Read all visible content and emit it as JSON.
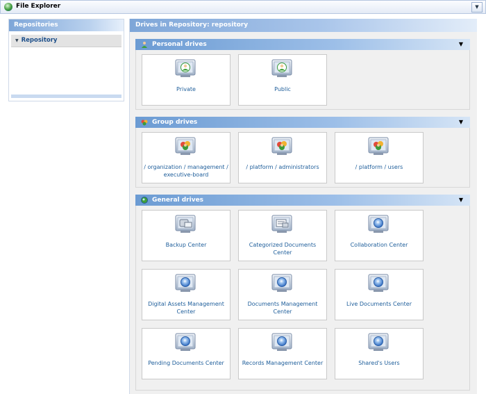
{
  "window": {
    "title": "File Explorer",
    "menu_glyph": "▼"
  },
  "left": {
    "header": "Repositories",
    "items": [
      {
        "label": "Repository",
        "arrow": "▼"
      }
    ]
  },
  "right": {
    "header": "Drives in Repository: repository",
    "collapse_glyph": "▼",
    "sections": [
      {
        "title": "Personal drives",
        "icon": "user-icon",
        "drives": [
          {
            "label": "Private",
            "icon": "user-drive-icon"
          },
          {
            "label": "Public",
            "icon": "user-drive-icon"
          }
        ]
      },
      {
        "title": "Group drives",
        "icon": "group-icon",
        "drives": [
          {
            "label": "/ organization / management / executive-board",
            "icon": "group-drive-icon"
          },
          {
            "label": "/ platform / administrators",
            "icon": "group-drive-icon"
          },
          {
            "label": "/ platform / users",
            "icon": "group-drive-icon"
          }
        ]
      },
      {
        "title": "General drives",
        "icon": "globe-icon",
        "drives": [
          {
            "label": "Backup Center",
            "icon": "backup-drive-icon"
          },
          {
            "label": "Categorized Documents Center",
            "icon": "categorized-drive-icon"
          },
          {
            "label": "Collaboration Center",
            "icon": "drive-icon"
          },
          {
            "label": "Digital Assets Management Center",
            "icon": "drive-icon"
          },
          {
            "label": "Documents Management Center",
            "icon": "drive-icon"
          },
          {
            "label": "Live Documents Center",
            "icon": "drive-icon"
          },
          {
            "label": "Pending Documents Center",
            "icon": "drive-icon"
          },
          {
            "label": "Records Management Center",
            "icon": "drive-icon"
          },
          {
            "label": "Shared's Users",
            "icon": "drive-icon"
          }
        ]
      }
    ]
  }
}
